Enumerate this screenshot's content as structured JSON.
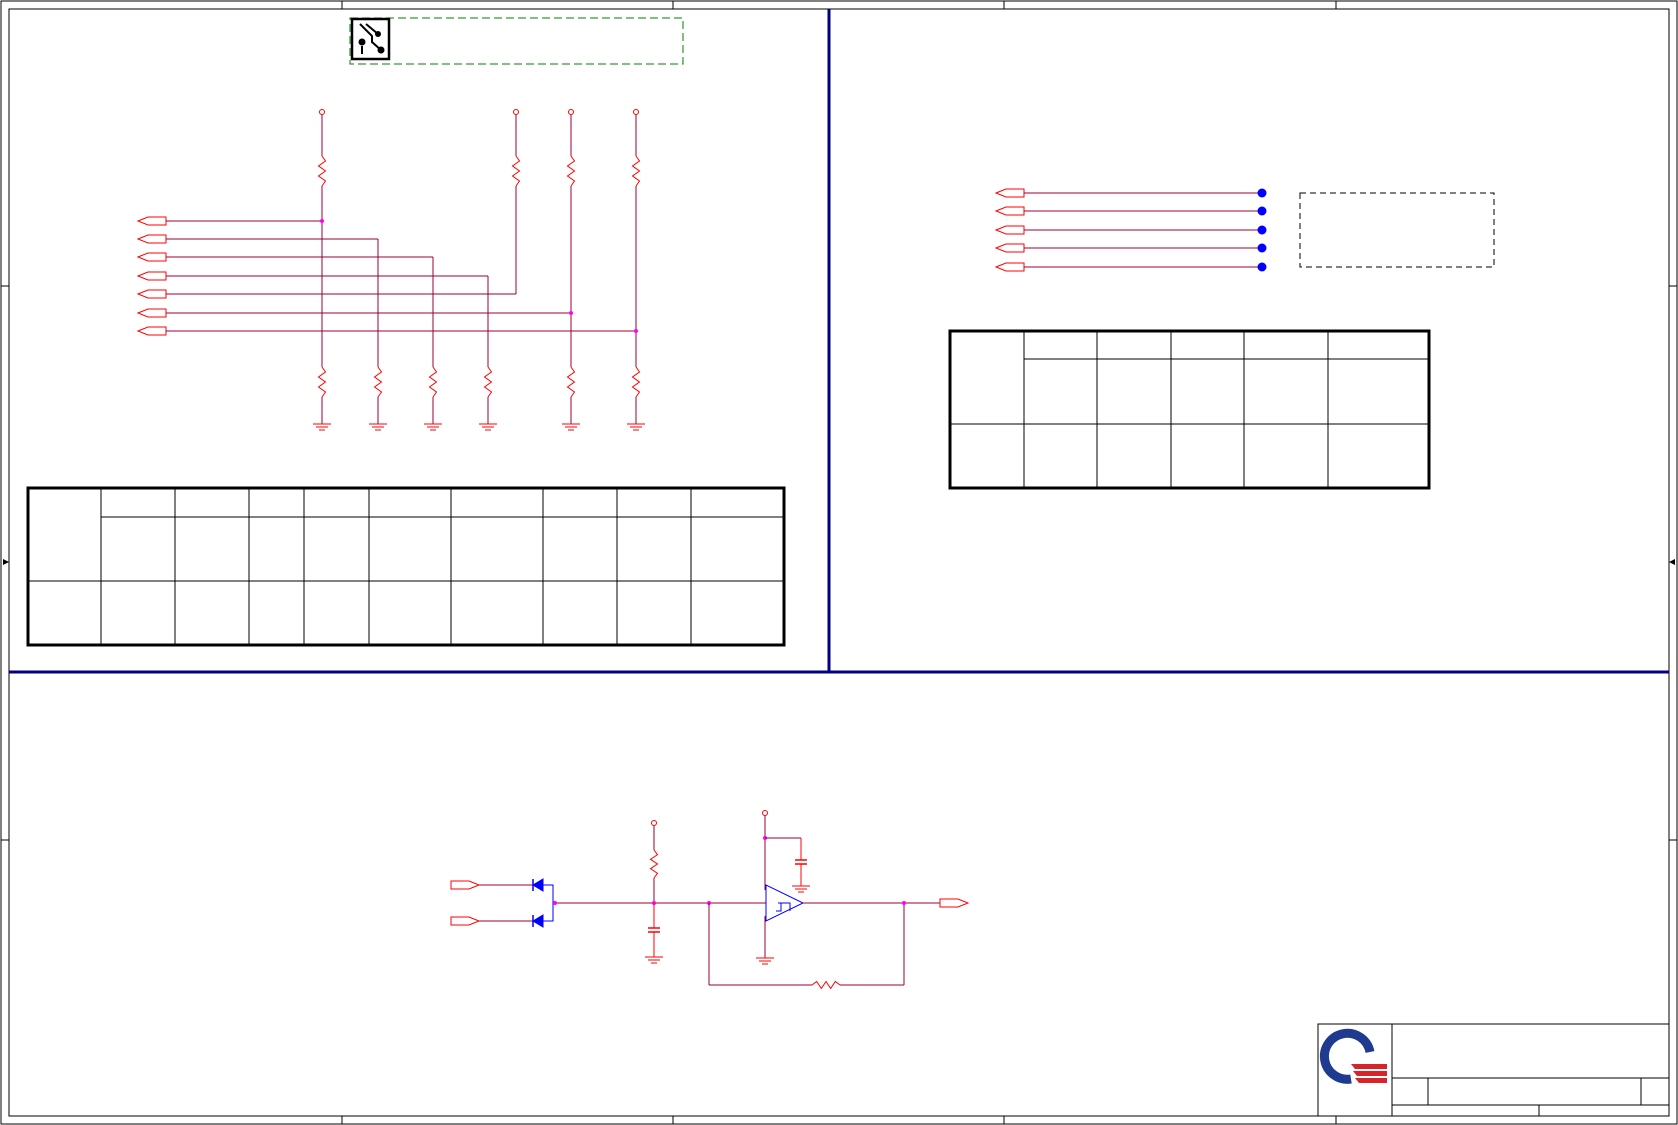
{
  "sheet": {
    "type": "electronic schematic (labels not legible in screenshot)",
    "colors": {
      "frame": "#000000",
      "divider": "#000080",
      "wire": "#990033",
      "component": "#ff0000",
      "junction": "#ff00ff",
      "semiconductor": "#0000ff",
      "bookmark_box": "#008000",
      "table_border": "#000000"
    }
  },
  "icons": {
    "bookmark": "circuit-board-icon",
    "company_logo": "company-logo-icon"
  },
  "top_left_block": {
    "input_ports": 7,
    "pullup_resistors": 4,
    "pulldown_resistors": 6,
    "ground_symbols": 6
  },
  "top_right_block": {
    "input_ports": 5,
    "test_points": 5
  },
  "bottom_block": {
    "input_ports": 2,
    "diodes": 2,
    "comparator": 1,
    "output_ports": 1
  },
  "tables": {
    "left_table": {
      "columns": 10,
      "rows": 3
    },
    "right_table": {
      "columns": 6,
      "rows": 3
    }
  }
}
